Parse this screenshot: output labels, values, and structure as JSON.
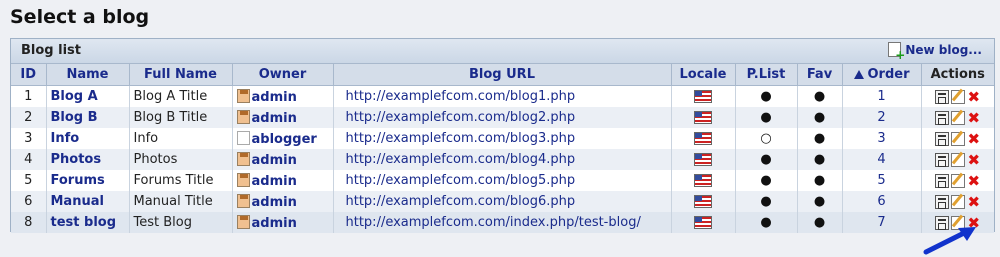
{
  "page": {
    "title": "Select a blog"
  },
  "panel": {
    "title": "Blog list",
    "new_blog_label": "New blog..."
  },
  "columns": [
    "ID",
    "Name",
    "Full Name",
    "Owner",
    "Blog URL",
    "Locale",
    "P.List",
    "Fav",
    "Order",
    "Actions"
  ],
  "rows": [
    {
      "id": "1",
      "name": "Blog A",
      "full_name": "Blog A Title",
      "owner": "admin",
      "owner_avatar": "avatar",
      "url": "http://examplefcom.com/blog1.php",
      "plist": "●",
      "fav": "●",
      "order": "1"
    },
    {
      "id": "2",
      "name": "Blog B",
      "full_name": "Blog B Title",
      "owner": "admin",
      "owner_avatar": "avatar",
      "url": "http://examplefcom.com/blog2.php",
      "plist": "●",
      "fav": "●",
      "order": "2"
    },
    {
      "id": "3",
      "name": "Info",
      "full_name": "Info",
      "owner": "ablogger",
      "owner_avatar": "blank",
      "url": "http://examplefcom.com/blog3.php",
      "plist": "○",
      "fav": "●",
      "order": "3"
    },
    {
      "id": "4",
      "name": "Photos",
      "full_name": "Photos",
      "owner": "admin",
      "owner_avatar": "avatar",
      "url": "http://examplefcom.com/blog4.php",
      "plist": "●",
      "fav": "●",
      "order": "4"
    },
    {
      "id": "5",
      "name": "Forums",
      "full_name": "Forums Title",
      "owner": "admin",
      "owner_avatar": "avatar",
      "url": "http://examplefcom.com/blog5.php",
      "plist": "●",
      "fav": "●",
      "order": "5"
    },
    {
      "id": "6",
      "name": "Manual",
      "full_name": "Manual Title",
      "owner": "admin",
      "owner_avatar": "avatar",
      "url": "http://examplefcom.com/blog6.php",
      "plist": "●",
      "fav": "●",
      "order": "6"
    },
    {
      "id": "8",
      "name": "test blog",
      "full_name": "Test Blog",
      "owner": "admin",
      "owner_avatar": "avatar",
      "url": "http://examplefcom.com/index.php/test-blog/",
      "plist": "●",
      "fav": "●",
      "order": "7"
    }
  ],
  "icons": {
    "locale": "us-flag-icon",
    "actions": [
      "properties-icon",
      "edit-icon",
      "delete-icon"
    ]
  },
  "colors": {
    "link": "#1a2b8c",
    "header_bg": "#d4dde9",
    "delete": "#dd1111",
    "annotation_arrow": "#1133cc"
  }
}
